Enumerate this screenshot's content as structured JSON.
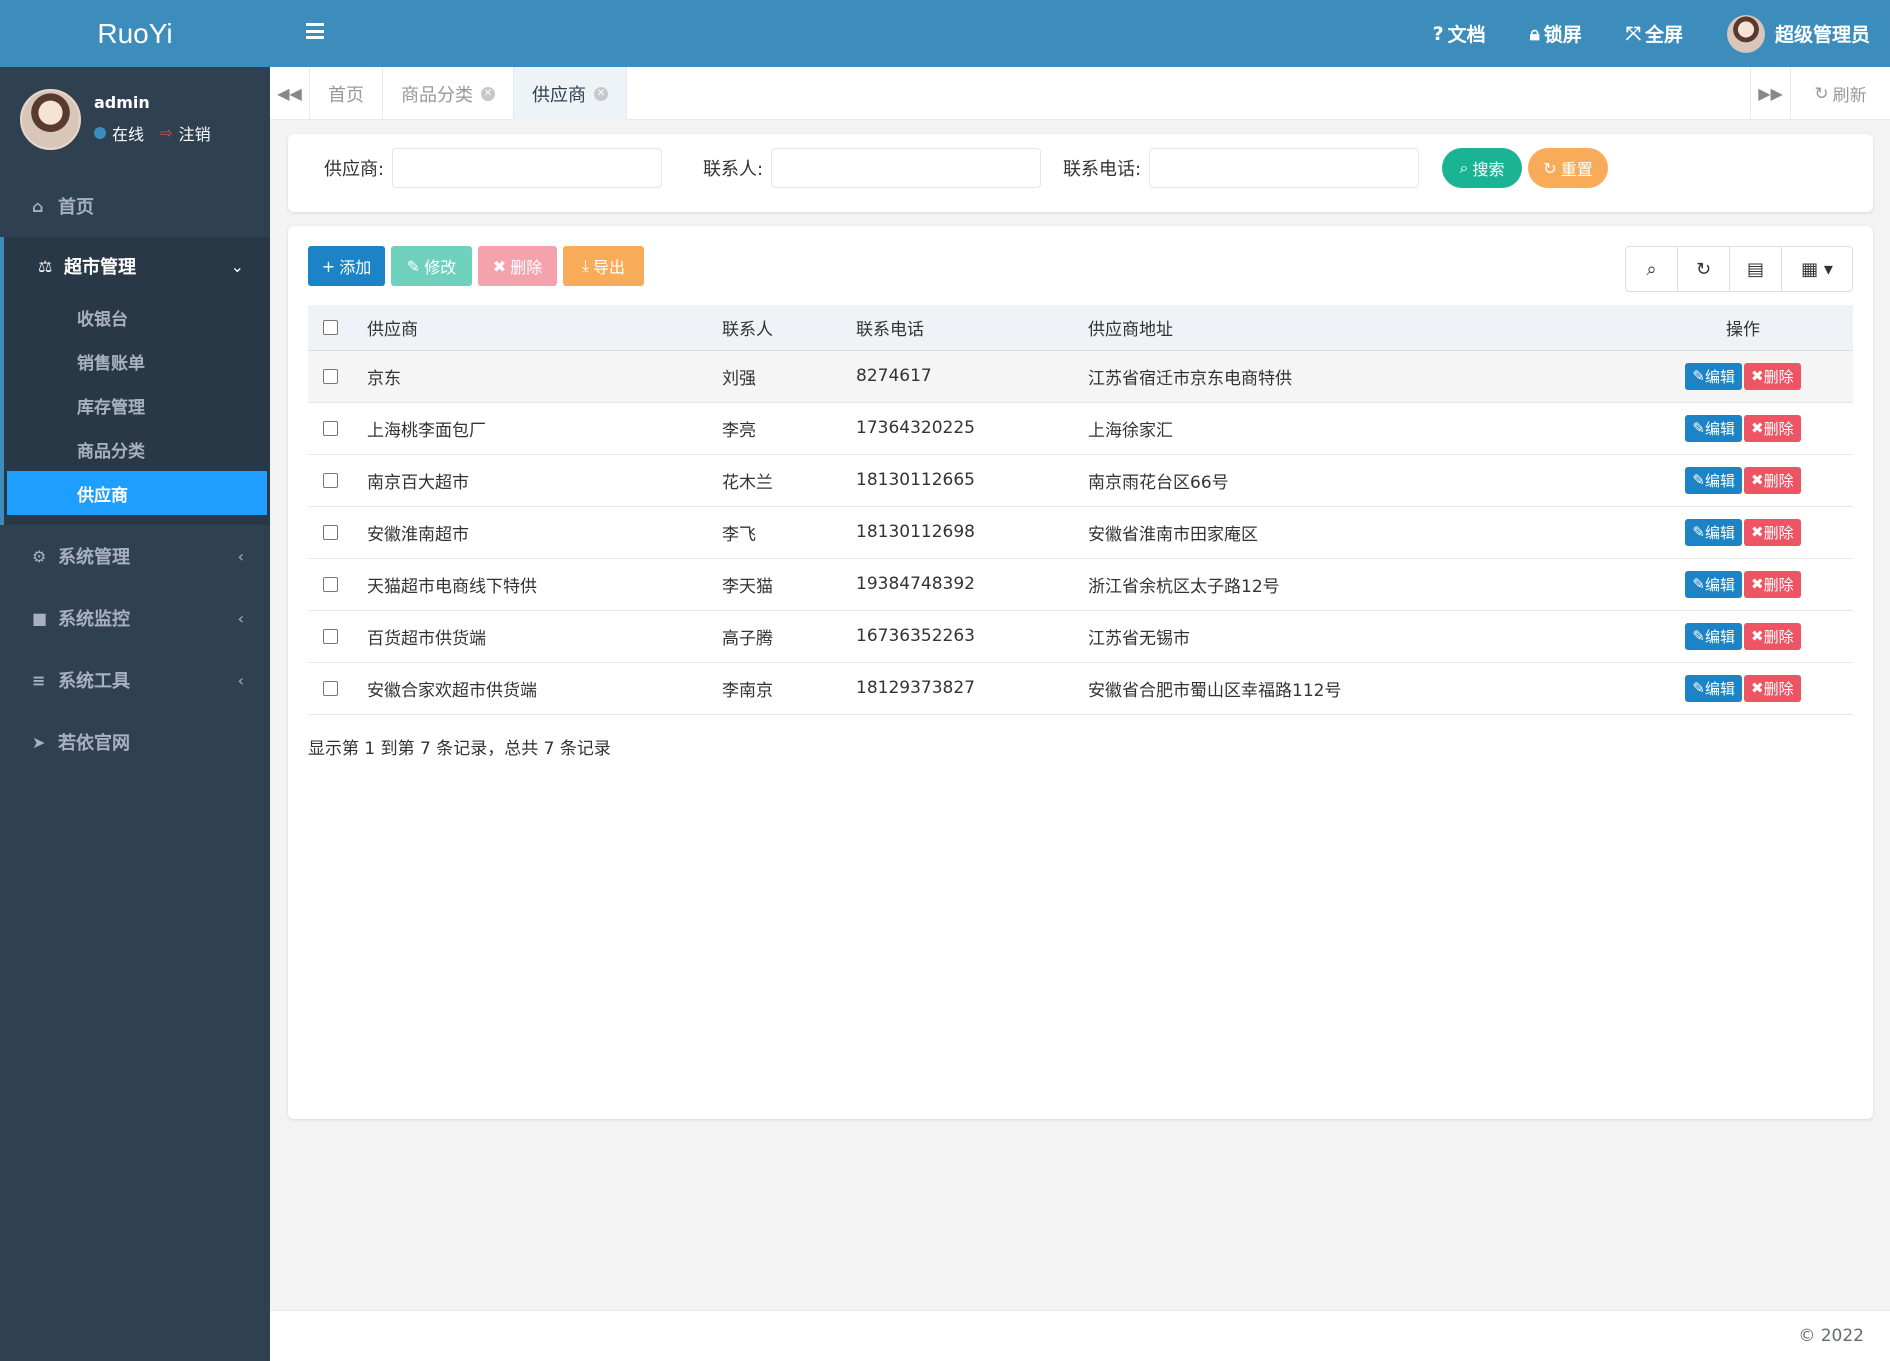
{
  "app": {
    "logo": "RuoYi"
  },
  "user": {
    "name": "admin",
    "status": "在线",
    "logout": "注销"
  },
  "sidebar": {
    "home": "首页",
    "group": {
      "label": "超市管理",
      "items": [
        "收银台",
        "销售账单",
        "库存管理",
        "商品分类",
        "供应商"
      ]
    },
    "others": [
      "系统管理",
      "系统监控",
      "系统工具",
      "若依官网"
    ]
  },
  "topbar": {
    "docs": "文档",
    "lock": "锁屏",
    "fullscreen": "全屏",
    "username": "超级管理员"
  },
  "tabs": {
    "items": [
      "首页",
      "商品分类",
      "供应商"
    ],
    "refresh": "刷新"
  },
  "search": {
    "supplier_label": "供应商:",
    "contact_label": "联系人:",
    "phone_label": "联系电话:",
    "search_btn": "搜索",
    "reset_btn": "重置"
  },
  "toolbar": {
    "add": "添加",
    "edit": "修改",
    "delete": "删除",
    "export": "导出"
  },
  "table": {
    "columns": [
      "供应商",
      "联系人",
      "联系电话",
      "供应商地址",
      "操作"
    ],
    "rows": [
      [
        "京东",
        "刘强",
        "8274617",
        "江苏省宿迁市京东电商特供"
      ],
      [
        "上海桃李面包厂",
        "李亮",
        "17364320225",
        "上海徐家汇"
      ],
      [
        "南京百大超市",
        "花木兰",
        "18130112665",
        "南京雨花台区66号"
      ],
      [
        "安徽淮南超市",
        "李飞",
        "18130112698",
        "安徽省淮南市田家庵区"
      ],
      [
        "天猫超市电商线下特供",
        "李天猫",
        "19384748392",
        "浙江省余杭区太子路12号"
      ],
      [
        "百货超市供货端",
        "高子腾",
        "16736352263",
        "江苏省无锡市"
      ],
      [
        "安徽合家欢超市供货端",
        "李南京",
        "18129373827",
        "安徽省合肥市蜀山区幸福路112号"
      ]
    ],
    "row_edit": "编辑",
    "row_delete": "删除"
  },
  "pagination": {
    "info": "显示第 1 到第 7 条记录，总共 7 条记录"
  },
  "footer": {
    "copyright": "© 2022"
  },
  "colors": {
    "primary": "#3c8dbc",
    "sidebar": "#2f4050",
    "active": "#1e9fff",
    "success": "#1ab394",
    "warning": "#f8ac59",
    "danger": "#ed5565"
  }
}
